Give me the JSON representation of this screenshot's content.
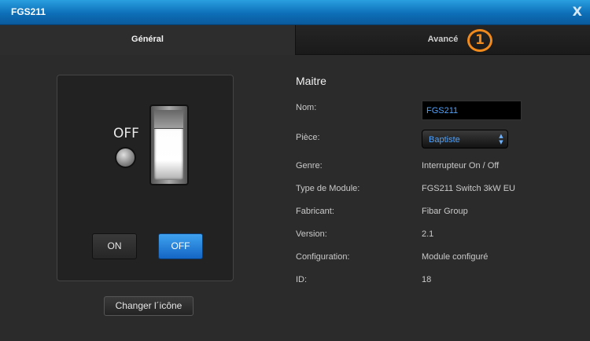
{
  "window": {
    "title": "FGS211",
    "close_label": "X"
  },
  "tabs": [
    {
      "label": "Général",
      "active": true
    },
    {
      "label": "Avancé",
      "active": false
    }
  ],
  "annotation_badge": "1",
  "device_panel": {
    "state_label": "OFF",
    "on_button": "ON",
    "off_button": "OFF",
    "change_icon_button": "Changer l´icône"
  },
  "section": {
    "title": "Maitre"
  },
  "fields": {
    "name": {
      "label": "Nom:",
      "value": "FGS211"
    },
    "room": {
      "label": "Pièce:",
      "value": "Baptiste"
    },
    "genre": {
      "label": "Genre:",
      "value": "Interrupteur On / Off"
    },
    "module_type": {
      "label": "Type de Module:",
      "value": "FGS211 Switch 3kW EU"
    },
    "manufacturer": {
      "label": "Fabricant:",
      "value": "Fibar Group"
    },
    "version": {
      "label": "Version:",
      "value": "2.1"
    },
    "configuration": {
      "label": "Configuration:",
      "value": "Module configuré"
    },
    "id": {
      "label": "ID:",
      "value": "18"
    }
  },
  "colors": {
    "title_bar": "#0d6fb8",
    "accent_blue": "#4ea3ff",
    "off_button": "#1466c4",
    "annotation": "#f08a1c"
  }
}
